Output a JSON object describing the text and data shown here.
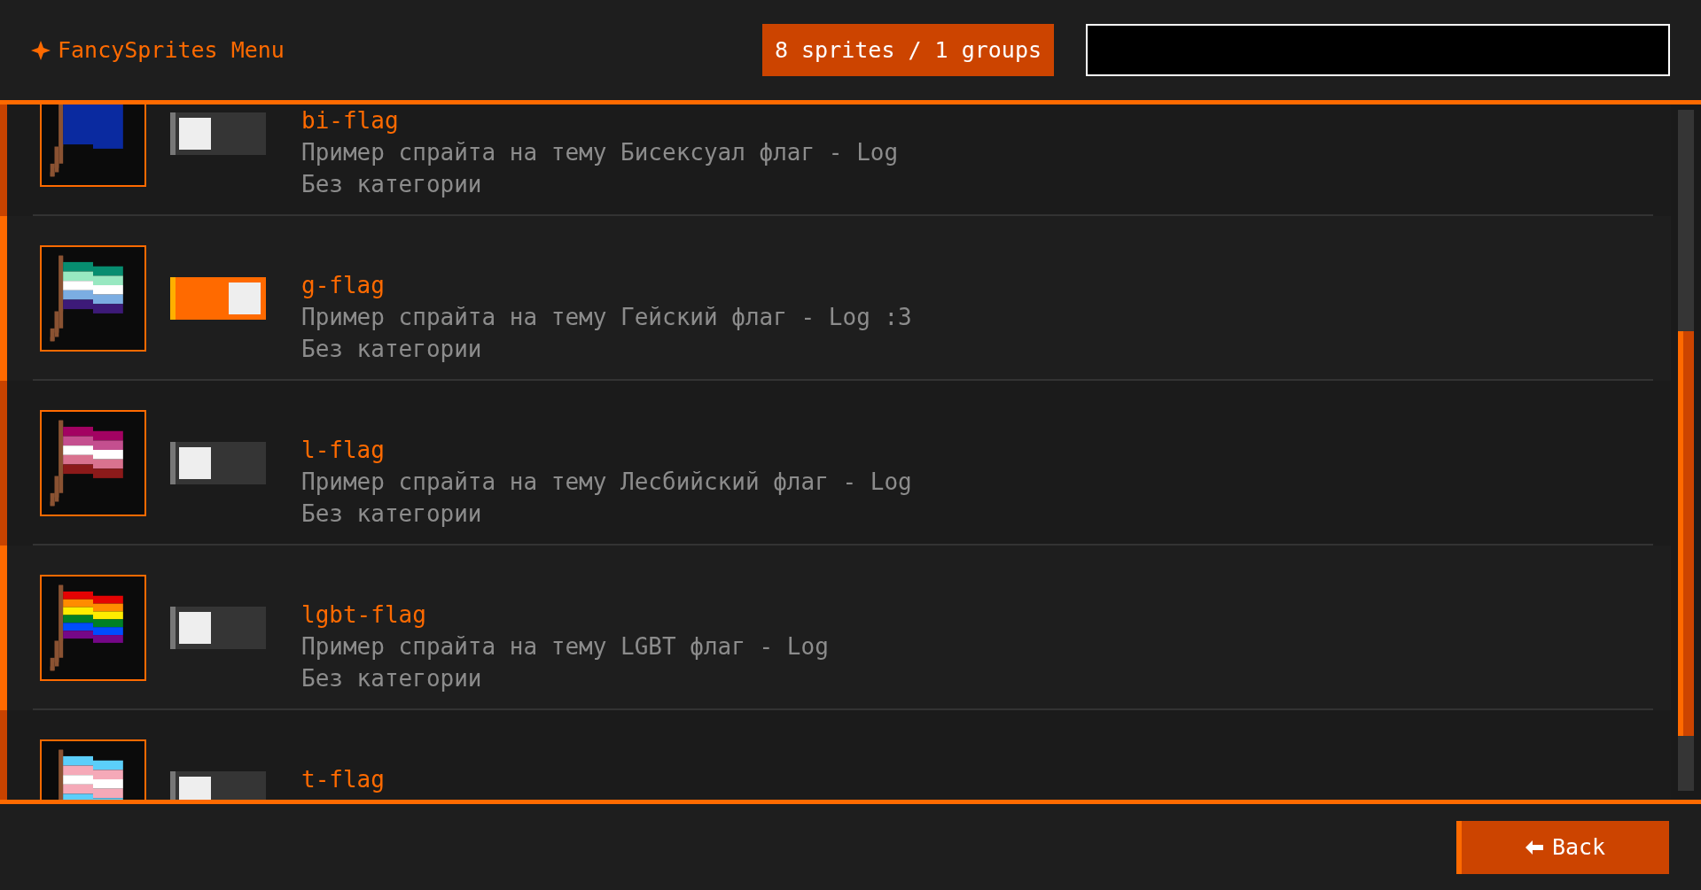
{
  "header": {
    "title": "FancySprites Menu",
    "counter": "8 sprites / 1 groups"
  },
  "sprites": [
    {
      "name": "bi-flag",
      "description": "Пример спрайта на тему Бисексуал флаг - Log",
      "category": "Без категории",
      "enabled": false
    },
    {
      "name": "g-flag",
      "description": "Пример спрайта на тему Гейский флаг - Log :3",
      "category": "Без категории",
      "enabled": true
    },
    {
      "name": "l-flag",
      "description": "Пример спрайта на тему Лесбийский флаг - Log",
      "category": "Без категории",
      "enabled": false
    },
    {
      "name": "lgbt-flag",
      "description": "Пример спрайта на тему LGBT флаг - Log",
      "category": "Без категории",
      "enabled": false
    },
    {
      "name": "t-flag",
      "enabled": false
    }
  ],
  "footer": {
    "back_button": "Back"
  }
}
